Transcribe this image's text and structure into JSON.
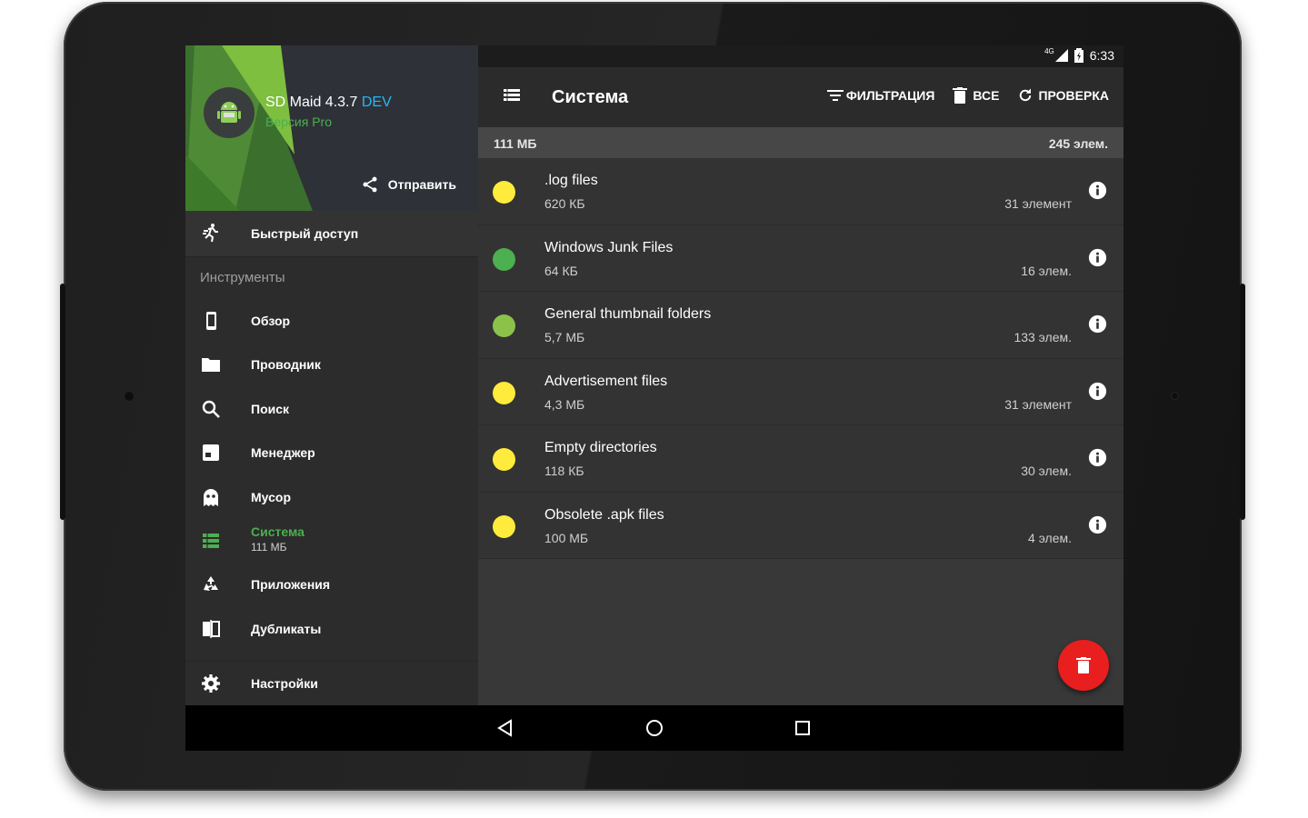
{
  "drawer": {
    "app_name": "SD Maid 4.3.7",
    "app_tag": "DEV",
    "app_sub": "Версия Pro",
    "share_label": "Отправить",
    "quick_access": "Быстрый доступ",
    "section_title": "Инструменты",
    "items": [
      {
        "label": "Обзор",
        "icon": "phone-icon"
      },
      {
        "label": "Проводник",
        "icon": "folder-icon"
      },
      {
        "label": "Поиск",
        "icon": "search-icon"
      },
      {
        "label": "Менеджер",
        "icon": "app-manager-icon"
      },
      {
        "label": "Мусор",
        "icon": "ghost-icon"
      },
      {
        "label": "Система",
        "sub": "111 МБ",
        "icon": "list-icon",
        "active": true
      },
      {
        "label": "Приложения",
        "icon": "recycle-icon"
      },
      {
        "label": "Дубликаты",
        "icon": "duplicates-icon"
      }
    ],
    "settings": "Настройки"
  },
  "status_bar": {
    "network": "4G",
    "time": "6:33"
  },
  "toolbar": {
    "title": "Система",
    "filter_label": "ФИЛЬТРАЦИЯ",
    "all_label": "ВСЕ",
    "check_label": "ПРОВЕРКА"
  },
  "summary": {
    "size": "111 МБ",
    "count": "245 элем."
  },
  "rows": [
    {
      "name": ".log files",
      "size": "620 КБ",
      "count": "31 элемент",
      "color": "#ffeb3b"
    },
    {
      "name": "Windows Junk Files",
      "size": "64 КБ",
      "count": "16 элем.",
      "color": "#4caf50"
    },
    {
      "name": "General thumbnail folders",
      "size": "5,7 МБ",
      "count": "133 элем.",
      "color": "#8bc34a"
    },
    {
      "name": "Advertisement files",
      "size": "4,3 МБ",
      "count": "31 элемент",
      "color": "#ffeb3b"
    },
    {
      "name": "Empty directories",
      "size": "118 КБ",
      "count": "30 элем.",
      "color": "#ffeb3b"
    },
    {
      "name": "Obsolete .apk files",
      "size": "100 МБ",
      "count": "4 элем.",
      "color": "#ffeb3b"
    }
  ],
  "colors": {
    "accent": "#4caf50",
    "fab": "#e91e1e",
    "dev": "#29b6f6"
  }
}
